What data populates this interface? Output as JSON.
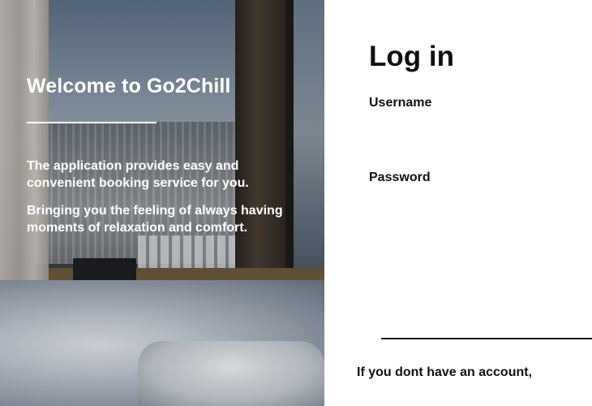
{
  "hero": {
    "title": "Welcome to Go2Chill",
    "paragraph_1": "The application provides easy and convenient booking service for you.",
    "paragraph_2": "Bringing you the feeling of always having moments of relaxation and comfort.",
    "text_color": "#ffffff"
  },
  "login": {
    "title": "Log in",
    "username_label": "Username",
    "username_value": "",
    "password_label": "Password",
    "password_value": "",
    "no_account_text": "If you dont have an account,"
  },
  "colors": {
    "panel_background": "#ffffff",
    "text_primary": "#111111",
    "divider": "#111111"
  }
}
